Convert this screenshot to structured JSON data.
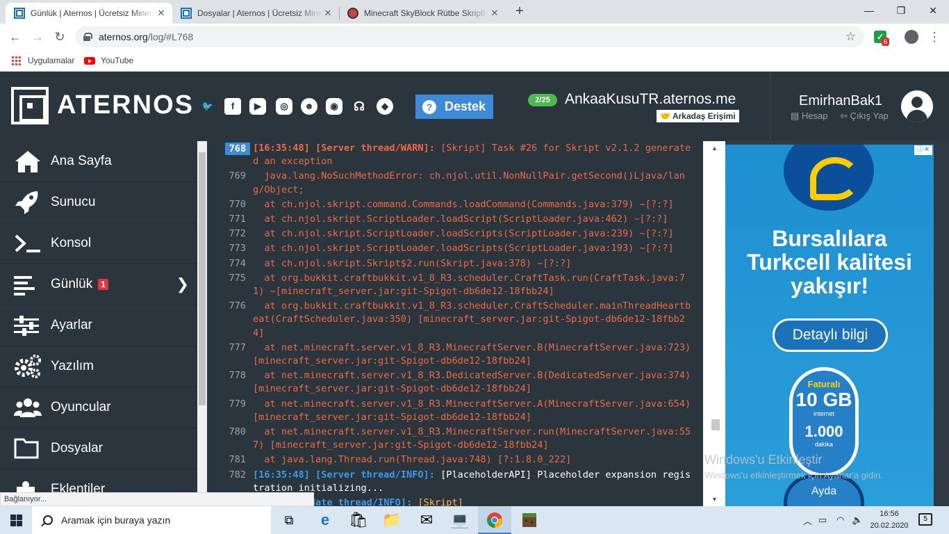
{
  "browser": {
    "tabs": [
      {
        "title": "Günlük | Aternos | Ücretsiz Minecraft Sunucusu",
        "active": true
      },
      {
        "title": "Dosyalar | Aternos | Ücretsiz Minecraft Sunucusu",
        "active": false
      },
      {
        "title": "Minecraft SkyBlock Rütbe Skripti",
        "active": false
      }
    ],
    "url_host": "aternos.org",
    "url_path": "/log/#L768",
    "bookmarks": [
      "Uygulamalar",
      "YouTube"
    ],
    "extension_badge": "6"
  },
  "header": {
    "brand": "ATERNOS",
    "support_label": "Destek",
    "players": "2/25",
    "server_address": "AnkaaKusuTR.aternos.me",
    "friend_access_label": "Arkadaş Erişimi",
    "username": "EmirhanBak1",
    "account_label": "Hesap",
    "logout_label": "Çıkış Yap"
  },
  "sidebar": {
    "items": [
      {
        "label": "Ana Sayfa",
        "icon": "home-icon"
      },
      {
        "label": "Sunucu",
        "icon": "rocket-icon"
      },
      {
        "label": "Konsol",
        "icon": "terminal-icon"
      },
      {
        "label": "Günlük",
        "icon": "log-lines-icon",
        "badge": "1"
      },
      {
        "label": "Ayarlar",
        "icon": "sliders-icon"
      },
      {
        "label": "Yazılım",
        "icon": "gears-icon"
      },
      {
        "label": "Oyuncular",
        "icon": "users-icon"
      },
      {
        "label": "Dosyalar",
        "icon": "folder-icon"
      },
      {
        "label": "Eklentiler",
        "icon": "puzzle-icon"
      }
    ]
  },
  "log": {
    "lines": [
      {
        "num": "768",
        "highlight": true,
        "prefix": "[16:35:48] [Server thread/WARN]:",
        "text": " [Skript] Task #26 for Skript v2.1.2 generated an exception",
        "level": "warn"
      },
      {
        "num": "769",
        "text": "  java.lang.NoSuchMethodError: ch.njol.util.NonNullPair.getSecond()Ljava/lang/Object;",
        "level": "warn"
      },
      {
        "num": "770",
        "text": "  at ch.njol.skript.command.Commands.loadCommand(Commands.java:379) ~[?:?]",
        "level": "warn"
      },
      {
        "num": "771",
        "text": "  at ch.njol.skript.ScriptLoader.loadScript(ScriptLoader.java:462) ~[?:?]",
        "level": "warn"
      },
      {
        "num": "772",
        "text": "  at ch.njol.skript.ScriptLoader.loadScripts(ScriptLoader.java:239) ~[?:?]",
        "level": "warn"
      },
      {
        "num": "773",
        "text": "  at ch.njol.skript.ScriptLoader.loadScripts(ScriptLoader.java:193) ~[?:?]",
        "level": "warn"
      },
      {
        "num": "774",
        "text": "  at ch.njol.skript.Skript$2.run(Skript.java:378) ~[?:?]",
        "level": "warn"
      },
      {
        "num": "775",
        "text": "  at org.bukkit.craftbukkit.v1_8_R3.scheduler.CraftTask.run(CraftTask.java:71) ~[minecraft_server.jar:git-Spigot-db6de12-18fbb24]",
        "level": "warn"
      },
      {
        "num": "776",
        "text": "  at org.bukkit.craftbukkit.v1_8_R3.scheduler.CraftScheduler.mainThreadHeartbeat(CraftScheduler.java:350) [minecraft_server.jar:git-Spigot-db6de12-18fbb24]",
        "level": "warn"
      },
      {
        "num": "777",
        "text": "  at net.minecraft.server.v1_8_R3.MinecraftServer.B(MinecraftServer.java:723) [minecraft_server.jar:git-Spigot-db6de12-18fbb24]",
        "level": "warn"
      },
      {
        "num": "778",
        "text": "  at net.minecraft.server.v1_8_R3.DedicatedServer.B(DedicatedServer.java:374) [minecraft_server.jar:git-Spigot-db6de12-18fbb24]",
        "level": "warn"
      },
      {
        "num": "779",
        "text": "  at net.minecraft.server.v1_8_R3.MinecraftServer.A(MinecraftServer.java:654) [minecraft_server.jar:git-Spigot-db6de12-18fbb24]",
        "level": "warn"
      },
      {
        "num": "780",
        "text": "  at net.minecraft.server.v1_8_R3.MinecraftServer.run(MinecraftServer.java:557) [minecraft_server.jar:git-Spigot-db6de12-18fbb24]",
        "level": "warn"
      },
      {
        "num": "781",
        "text": "  at java.lang.Thread.run(Thread.java:748) [?:1.8.0_222]",
        "level": "warn"
      },
      {
        "num": "782",
        "prefix": "[16:35:48] [Server thread/INFO]:",
        "text": " [PlaceholderAPI] Placeholder expansion registration initializing...",
        "level": "info"
      },
      {
        "num": "",
        "prefix": "[Skript update thread/INFO]:",
        "text": " ",
        "skript": "[Skript]",
        "level": "info"
      }
    ]
  },
  "ad": {
    "headline": [
      "Bursalılara",
      "Turkcell kalitesi",
      "yakışır!"
    ],
    "cta": "Detaylı bilgi",
    "pill_top": "Faturalı",
    "pill_gb": "10 GB",
    "pill_internet": "internet",
    "pill_minutes": "1.000",
    "pill_minutes_label": "dakika",
    "pill2_top": "Ayda"
  },
  "windows_activation": {
    "title": "Windows'u Etkinleştir",
    "subtitle": "Windows'u etkinleştirmek için Ayarlar'a gidin."
  },
  "status_bar": "Bağlanıyor...",
  "taskbar": {
    "search_placeholder": "Aramak için buraya yazın",
    "time": "16:56",
    "date": "20.02.2020",
    "notifications": "5"
  }
}
